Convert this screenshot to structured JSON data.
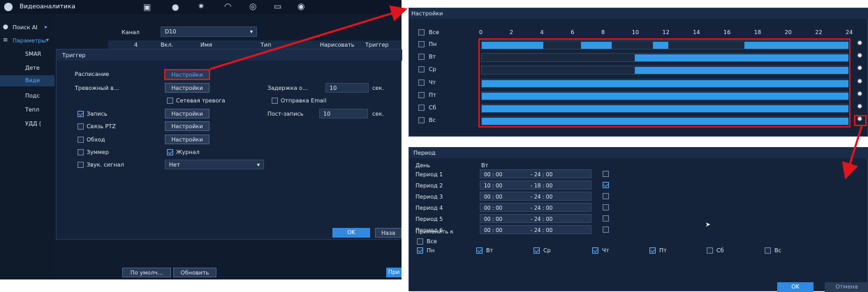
{
  "topbar": {
    "title": "Видеоаналитика"
  },
  "sidebar": {
    "items": [
      {
        "label": "Поиск AI"
      },
      {
        "label": "Параметры"
      },
      {
        "label": "SMAR"
      },
      {
        "label": "Дете"
      },
      {
        "label": "Виде"
      },
      {
        "label": "Подс"
      },
      {
        "label": "Тепл"
      },
      {
        "label": "УДД ("
      }
    ]
  },
  "main": {
    "channel_label": "Канал",
    "channel_value": "D10",
    "columns": [
      "Вкл.",
      "Имя",
      "Тип",
      "Нарисовать",
      "Триггер"
    ],
    "row_number": "4",
    "btn_default": "По умолч...",
    "btn_refresh": "Обновить",
    "btn_apply": "При"
  },
  "trigger": {
    "title": "Триггер",
    "schedule_label": "Расписание",
    "schedule_btn": "Настройки",
    "alarm_label": "Тревожный в...",
    "alarm_btn": "Настройки",
    "delay_label": "Задержка о...",
    "delay_value": "10",
    "delay_unit": "сек.",
    "net_alarm": "Сетевая тревога",
    "send_email": "Отправка Email",
    "record_label": "Запись",
    "record_btn": "Настройки",
    "post_record_label": "Пост-запись",
    "post_record_value": "10",
    "post_record_unit": "сек.",
    "ptz_label": "Связь PTZ",
    "ptz_btn": "Настройки",
    "tour_label": "Обход",
    "tour_btn": "Настройки",
    "buzzer_label": "Зуммер",
    "journal_label": "Журнал",
    "sound_label": "Звук. сигнал",
    "sound_value": "Нет",
    "ok_label": "OK",
    "back_label": "Наза"
  },
  "schedule": {
    "title": "Настройки",
    "all_label": "Все",
    "hours": [
      "0",
      "2",
      "4",
      "6",
      "8",
      "10",
      "12",
      "14",
      "16",
      "18",
      "20",
      "22",
      "24"
    ],
    "days": [
      {
        "label": "Пн",
        "segments": [
          [
            0,
            4
          ],
          [
            6.5,
            8.5
          ],
          [
            11.2,
            12.2
          ],
          [
            17.2,
            24
          ]
        ]
      },
      {
        "label": "Вт",
        "segments": [
          [
            10,
            24
          ]
        ]
      },
      {
        "label": "Ср",
        "segments": [
          [
            10,
            24
          ]
        ]
      },
      {
        "label": "Чт",
        "segments": [
          [
            0,
            24
          ]
        ]
      },
      {
        "label": "Пт",
        "segments": [
          [
            0,
            24
          ]
        ]
      },
      {
        "label": "Сб",
        "segments": [
          [
            0,
            24
          ]
        ]
      },
      {
        "label": "Вс",
        "segments": [
          [
            0,
            24
          ]
        ]
      }
    ]
  },
  "period": {
    "title": "Период",
    "day_label": "День",
    "day_value": "Вт",
    "periods": [
      {
        "label": "Период 1",
        "start": "00 : 00",
        "end": "24 : 00",
        "checked": false
      },
      {
        "label": "Период 2",
        "start": "10 : 00",
        "end": "18 : 00",
        "checked": true
      },
      {
        "label": "Период 3",
        "start": "00 : 00",
        "end": "24 : 00",
        "checked": false
      },
      {
        "label": "Период 4",
        "start": "00 : 00",
        "end": "24 : 00",
        "checked": false
      },
      {
        "label": "Период 5",
        "start": "00 : 00",
        "end": "24 : 00",
        "checked": false
      },
      {
        "label": "Период 6",
        "start": "00 : 00",
        "end": "24 : 00",
        "checked": false
      }
    ],
    "apply_to_label": "Применить к",
    "all_label": "Все",
    "apply_days": [
      {
        "label": "Пн",
        "checked": true
      },
      {
        "label": "Вт",
        "checked": true
      },
      {
        "label": "Ср",
        "checked": true
      },
      {
        "label": "Чт",
        "checked": true
      },
      {
        "label": "Пт",
        "checked": true
      },
      {
        "label": "Сб",
        "checked": false
      },
      {
        "label": "Вс",
        "checked": false
      }
    ],
    "ok_label": "OK",
    "cancel_label": "Отмена"
  },
  "colors": {
    "accent": "#2f9be9",
    "highlight": "#e0141e",
    "panel": "#15233a"
  }
}
